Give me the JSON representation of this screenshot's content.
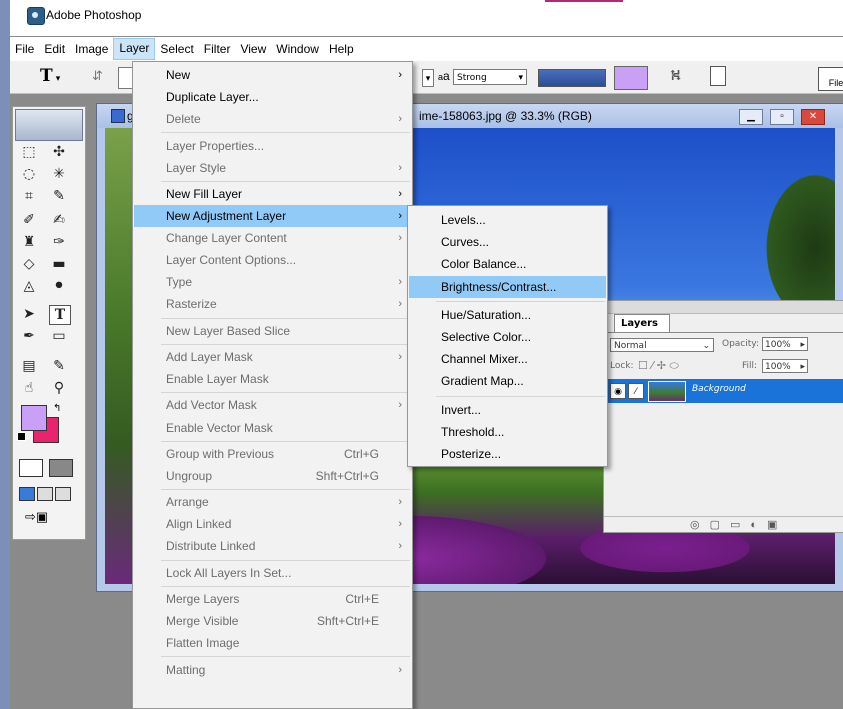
{
  "app": {
    "title": "Adobe Photoshop"
  },
  "menubar": {
    "items": [
      "File",
      "Edit",
      "Image",
      "Layer",
      "Select",
      "Filter",
      "View",
      "Window",
      "Help"
    ],
    "active": "Layer"
  },
  "options_bar": {
    "tool_glyph": "T",
    "aa_label": "a",
    "aa_value": "Strong",
    "file_browser_label": "File"
  },
  "document": {
    "title": "ime-158063.jpg @ 33.3% (RGB)",
    "title_prefix": "g"
  },
  "layers_panel": {
    "tab": "Layers",
    "blend_mode": "Normal",
    "opacity_label": "Opacity:",
    "opacity_value": "100%",
    "lock_label": "Lock:",
    "fill_label": "Fill:",
    "fill_value": "100%",
    "layer_name": "Background"
  },
  "layer_menu": [
    {
      "label": "New",
      "submenu": true,
      "enabled": true
    },
    {
      "label": "Duplicate Layer...",
      "enabled": true
    },
    {
      "label": "Delete",
      "submenu": true,
      "enabled": false
    },
    {
      "sep": true
    },
    {
      "label": "Layer Properties...",
      "enabled": false
    },
    {
      "label": "Layer Style",
      "submenu": true,
      "enabled": false
    },
    {
      "sep": true
    },
    {
      "label": "New Fill Layer",
      "submenu": true,
      "enabled": true
    },
    {
      "label": "New Adjustment Layer",
      "submenu": true,
      "enabled": true,
      "highlighted": true
    },
    {
      "label": "Change Layer Content",
      "submenu": true,
      "enabled": false
    },
    {
      "label": "Layer Content Options...",
      "enabled": false
    },
    {
      "label": "Type",
      "submenu": true,
      "enabled": false
    },
    {
      "label": "Rasterize",
      "submenu": true,
      "enabled": false
    },
    {
      "sep": true
    },
    {
      "label": "New Layer Based Slice",
      "enabled": false
    },
    {
      "sep": true
    },
    {
      "label": "Add Layer Mask",
      "submenu": true,
      "enabled": false
    },
    {
      "label": "Enable Layer Mask",
      "enabled": false
    },
    {
      "sep": true
    },
    {
      "label": "Add Vector Mask",
      "submenu": true,
      "enabled": false
    },
    {
      "label": "Enable Vector Mask",
      "enabled": false
    },
    {
      "sep": true
    },
    {
      "label": "Group with Previous",
      "shortcut": "Ctrl+G",
      "enabled": false
    },
    {
      "label": "Ungroup",
      "shortcut": "Shft+Ctrl+G",
      "enabled": false
    },
    {
      "sep": true
    },
    {
      "label": "Arrange",
      "submenu": true,
      "enabled": false
    },
    {
      "label": "Align Linked",
      "submenu": true,
      "enabled": false
    },
    {
      "label": "Distribute Linked",
      "submenu": true,
      "enabled": false
    },
    {
      "sep": true
    },
    {
      "label": "Lock All Layers In Set...",
      "enabled": false
    },
    {
      "sep": true
    },
    {
      "label": "Merge Layers",
      "shortcut": "Ctrl+E",
      "enabled": false
    },
    {
      "label": "Merge Visible",
      "shortcut": "Shft+Ctrl+E",
      "enabled": false
    },
    {
      "label": "Flatten Image",
      "enabled": false
    },
    {
      "sep": true
    },
    {
      "label": "Matting",
      "submenu": true,
      "enabled": false
    }
  ],
  "adjustment_submenu": [
    {
      "label": "Levels..."
    },
    {
      "label": "Curves..."
    },
    {
      "label": "Color Balance..."
    },
    {
      "label": "Brightness/Contrast...",
      "highlighted": true
    },
    {
      "sep": true
    },
    {
      "label": "Hue/Saturation..."
    },
    {
      "label": "Selective Color..."
    },
    {
      "label": "Channel Mixer..."
    },
    {
      "label": "Gradient Map..."
    },
    {
      "sep": true
    },
    {
      "label": "Invert..."
    },
    {
      "label": "Threshold..."
    },
    {
      "label": "Posterize..."
    }
  ],
  "colors": {
    "foreground": "#c9a0f5",
    "background": "#e8246e",
    "highlight": "#91c9f7",
    "selected_layer": "#1a73d8"
  }
}
